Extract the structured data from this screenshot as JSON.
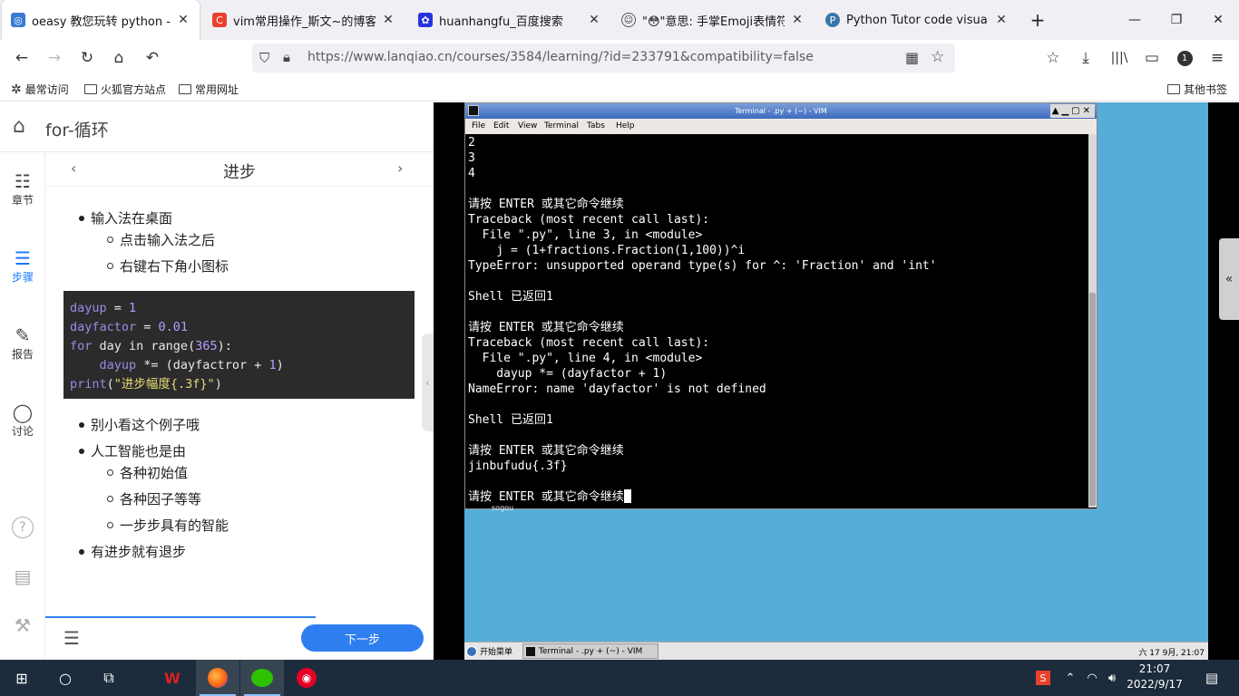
{
  "tabs": [
    {
      "title": "oeasy 教您玩转 python - for-循环",
      "icon": "oeasy-icon",
      "color": "#3a7bd5"
    },
    {
      "title": "vim常用操作_斯文~的博客-CSDN",
      "icon": "csdn-icon",
      "color": "#e8412c"
    },
    {
      "title": "huanhangfu_百度搜索",
      "icon": "baidu-paw-icon",
      "color": "#2932e1"
    },
    {
      "title": "\"😳\"意思: 手掌Emoji表情符号 | E",
      "icon": "emoji-icon",
      "color": "#555555"
    },
    {
      "title": "Python Tutor code visualizer:",
      "icon": "python-icon",
      "color": "#3b77a8"
    }
  ],
  "url": "https://www.lanqiao.cn/courses/3584/learning/?id=233791&compatibility=false",
  "bookmarks": {
    "items": [
      "最常访问",
      "火狐官方站点",
      "常用网址"
    ],
    "other": "其他书签"
  },
  "badge_count": "1",
  "lesson": {
    "title": "for-循环",
    "step_title": "进步",
    "sidebar": [
      {
        "label": "章节",
        "icon": "chapter-icon"
      },
      {
        "label": "步骤",
        "icon": "steps-list-icon"
      },
      {
        "label": "报告",
        "icon": "report-pen-icon"
      },
      {
        "label": "讨论",
        "icon": "discussion-bubble-icon"
      }
    ],
    "list_a": {
      "item": "输入法在桌面",
      "sub": [
        "点击输入法之后",
        "右键右下角小图标"
      ]
    },
    "code": {
      "line1_var": "dayup",
      "line1_op": " = ",
      "line1_num": "1",
      "line2_var": "dayfactor",
      "line2_op": " = ",
      "line2_num": "0.01",
      "line3_kw": "for",
      "line3_mid": " day ",
      "line3_kw2": "in",
      "line3_fn": " range(",
      "line3_num": "365",
      "line3_end": "):",
      "line4_indent": "    ",
      "line4_var": "dayup",
      "line4_mid": " *= (dayfactror + ",
      "line4_num": "1",
      "line4_end": ")",
      "line5_kw": "print",
      "line5_open": "(",
      "line5_str": "\"进步幅度{.3f}\"",
      "line5_end": ")"
    },
    "list_b": [
      {
        "item": "别小看这个例子哦",
        "sub": []
      },
      {
        "item": "人工智能也是由",
        "sub": [
          "各种初始值",
          "各种因子等等",
          "一步步具有的智能"
        ]
      },
      {
        "item": "有进步就有退步",
        "sub": []
      }
    ],
    "next_label": "下一步"
  },
  "terminal": {
    "title": "Terminal - .py + (~) - VIM",
    "menu": [
      "File",
      "Edit",
      "View",
      "Terminal",
      "Tabs",
      "Help"
    ],
    "lines": [
      "2",
      "3",
      "4",
      "",
      "请按 ENTER 或其它命令继续",
      "Traceback (most recent call last):",
      "  File \".py\", line 3, in <module>",
      "    j = (1+fractions.Fraction(1,100))^i",
      "TypeError: unsupported operand type(s) for ^: 'Fraction' and 'int'",
      "",
      "Shell 已返回1",
      "",
      "请按 ENTER 或其它命令继续",
      "Traceback (most recent call last):",
      "  File \".py\", line 4, in <module>",
      "    dayup *= (dayfactor + 1)",
      "NameError: name 'dayfactor' is not defined",
      "",
      "Shell 已返回1",
      "",
      "请按 ENTER 或其它命令继续",
      "jinbufudu{.3f}",
      ""
    ],
    "prompt_line": "请按 ENTER 或其它命令继续"
  },
  "vm_taskbar": {
    "start": "开始菜单",
    "task": "Terminal - .py + (~) - VIM",
    "clock": "六 17 9月, 21:07",
    "sogou": "sogou"
  },
  "taskbar": {
    "time": "21:07",
    "date": "2022/9/17"
  }
}
